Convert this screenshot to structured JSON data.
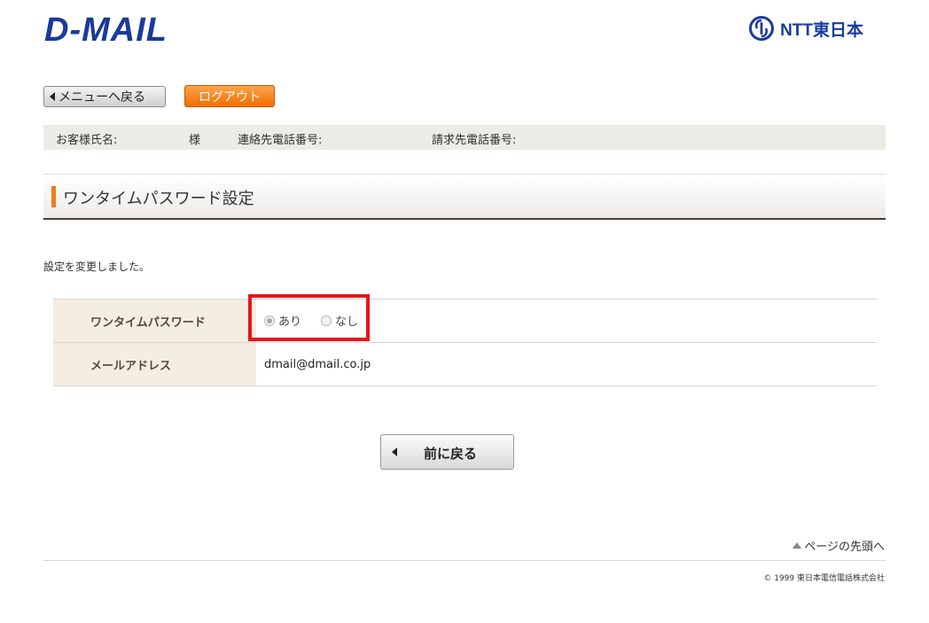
{
  "header": {
    "logo_text": "D-MAIL",
    "company": "NTT東日本"
  },
  "nav": {
    "menu_back_label": "メニューへ戻る",
    "logout_label": "ログアウト"
  },
  "customer": {
    "name_label": "お客様氏名:",
    "name_suffix": "様",
    "contact_phone_label": "連絡先電話番号:",
    "billing_phone_label": "請求先電話番号:"
  },
  "section": {
    "title": "ワンタイムパスワード設定"
  },
  "message": "設定を変更しました。",
  "settings": {
    "otp_label": "ワンタイムパスワード",
    "otp_options": [
      "あり",
      "なし"
    ],
    "otp_selected": "あり",
    "email_label": "メールアドレス",
    "email_value": "dmail@dmail.co.jp"
  },
  "buttons": {
    "back_label": "前に戻る"
  },
  "footer": {
    "page_top_label": "ページの先頭へ",
    "copyright": "© 1999 東日本電信電話株式会社"
  },
  "colors": {
    "brand_blue": "#1a3a9c",
    "accent_orange": "#f07a1a",
    "highlight_red": "#e8141c"
  }
}
